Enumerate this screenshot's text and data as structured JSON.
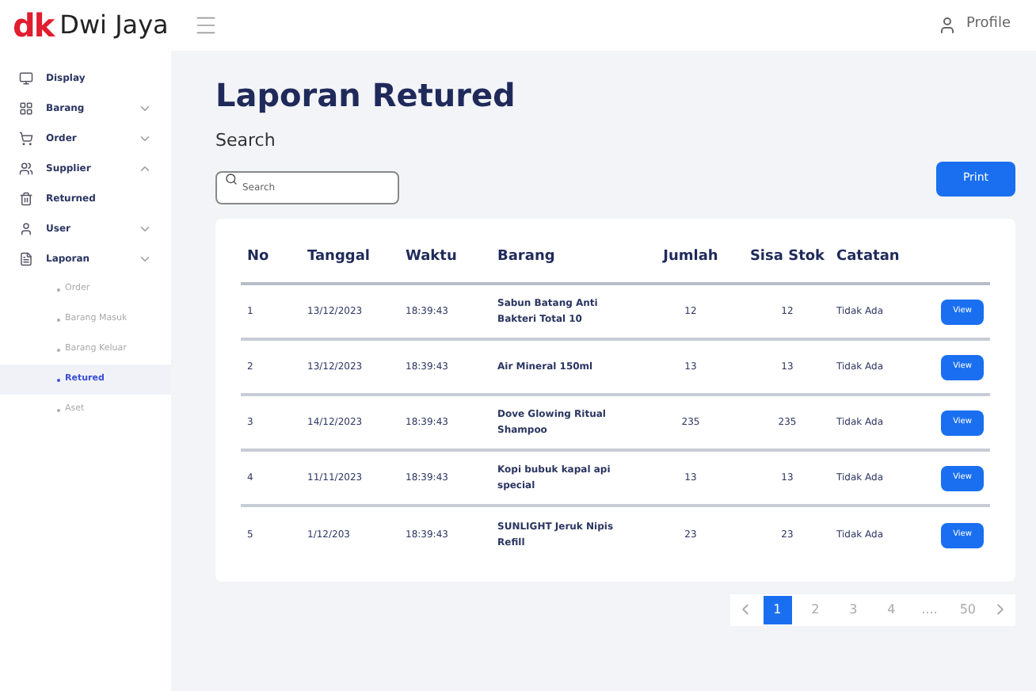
{
  "brand": {
    "mark": "dk",
    "name": "Dwi Jaya"
  },
  "header": {
    "profile": "Profile"
  },
  "sidebar": {
    "items": [
      {
        "label": "Display"
      },
      {
        "label": "Barang",
        "expanded": false
      },
      {
        "label": "Order",
        "expanded": false
      },
      {
        "label": "Supplier",
        "expanded": true
      },
      {
        "label": "Returned"
      },
      {
        "label": "User",
        "expanded": false
      },
      {
        "label": "Laporan",
        "expanded": false,
        "children": [
          {
            "label": "Order",
            "selected": false
          },
          {
            "label": "Barang Masuk",
            "selected": false
          },
          {
            "label": "Barang Keluar",
            "selected": false
          },
          {
            "label": "Retured",
            "selected": true
          },
          {
            "label": "Aset",
            "selected": false
          }
        ]
      }
    ]
  },
  "page": {
    "title": "Laporan Retured",
    "search_label": "Search",
    "search": {
      "placeholder": "Search"
    },
    "print_button": "Print"
  },
  "table": {
    "columns": [
      "No",
      "Tanggal",
      "Waktu",
      "Barang",
      "Jumlah",
      "Sisa Stok",
      "Catatan"
    ],
    "rows": [
      {
        "cells": [
          "1",
          "13/12/2023",
          "18:39:43",
          "Sabun Batang Anti Bakteri Total 10",
          "12",
          "12",
          "Tidak Ada"
        ],
        "action": "View"
      },
      {
        "cells": [
          "2",
          "13/12/2023",
          "18:39:43",
          "Air Mineral 150ml",
          "13",
          "13",
          "Tidak Ada"
        ],
        "action": "View"
      },
      {
        "cells": [
          "3",
          "14/12/2023",
          "18:39:43",
          "Dove Glowing Ritual Shampoo",
          "235",
          "235",
          "Tidak Ada"
        ],
        "action": "View"
      },
      {
        "cells": [
          "4",
          "11/11/2023",
          "18:39:43",
          "Kopi bubuk kapal api special",
          "13",
          "13",
          "Tidak Ada"
        ],
        "action": "View"
      },
      {
        "cells": [
          "5",
          "1/12/203",
          "18:39:43",
          "SUNLIGHT Jeruk Nipis Refill",
          "23",
          "23",
          "Tidak Ada"
        ],
        "action": "View"
      }
    ]
  },
  "pagination": {
    "pages": [
      {
        "label": "1",
        "selected": true
      },
      {
        "label": "2",
        "selected": false
      },
      {
        "label": "3",
        "selected": false
      },
      {
        "label": "4",
        "selected": false
      },
      {
        "label": "....",
        "selected": false
      },
      {
        "label": "50",
        "selected": false
      }
    ]
  }
}
